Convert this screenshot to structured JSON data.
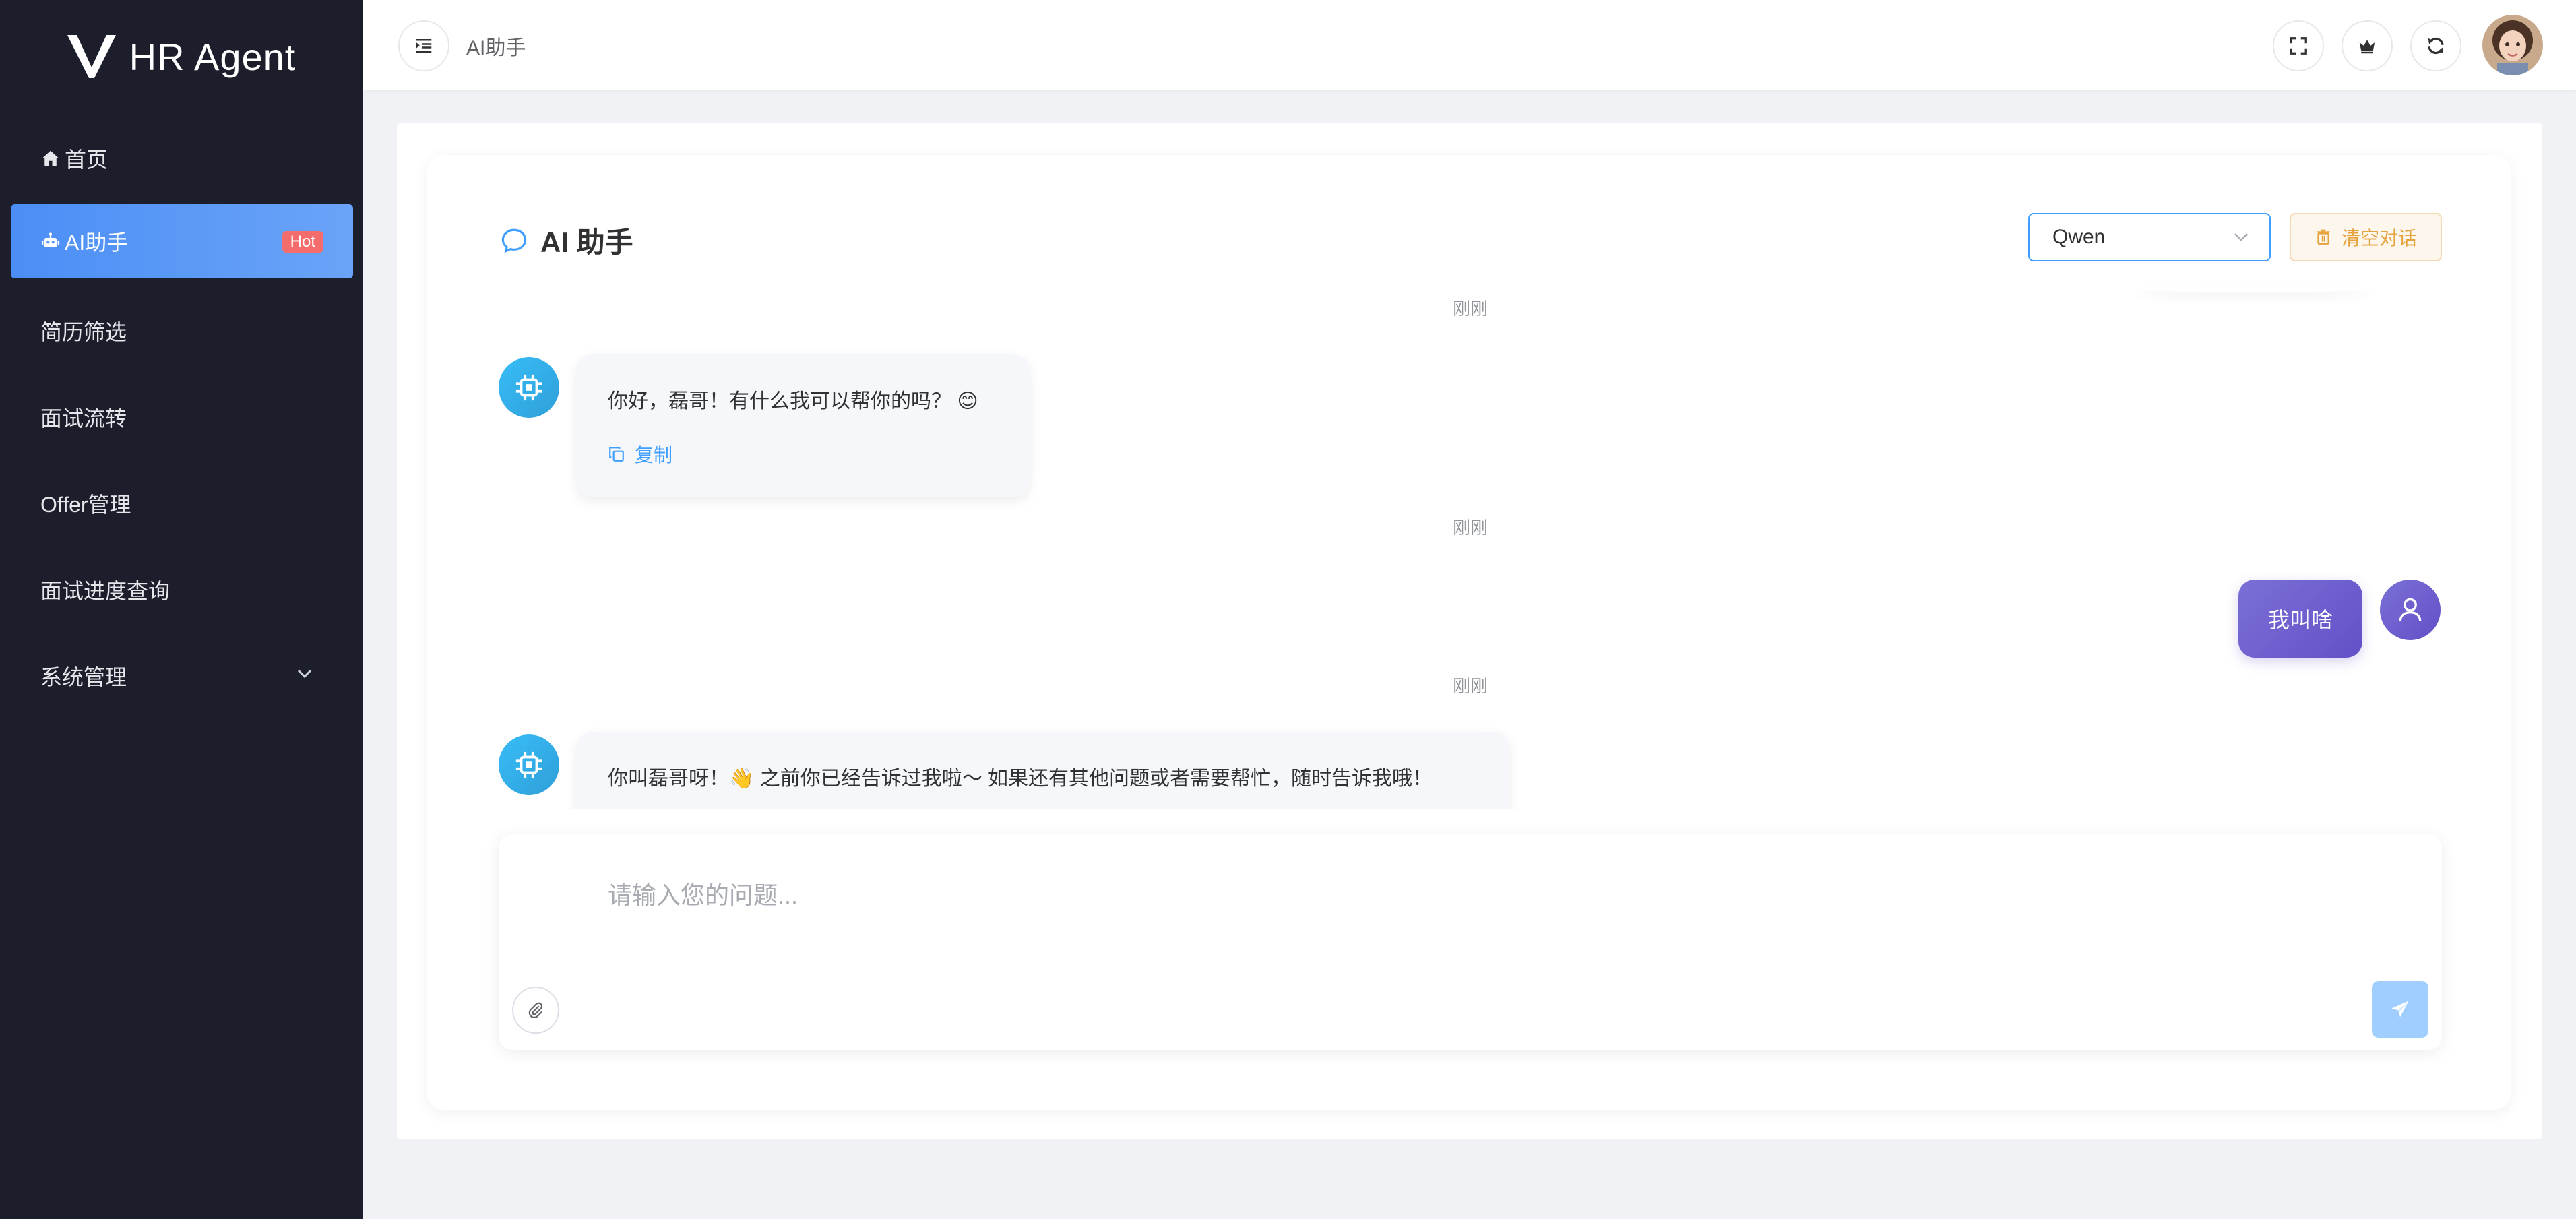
{
  "app": {
    "logo_text": "HR Agent"
  },
  "sidebar": {
    "items": [
      {
        "label": "首页",
        "icon": "home-icon"
      },
      {
        "label": "AI助手",
        "icon": "robot-icon",
        "badge": "Hot",
        "active": true
      },
      {
        "label": "简历筛选"
      },
      {
        "label": "面试流转"
      },
      {
        "label": "Offer管理"
      },
      {
        "label": "面试进度查询"
      },
      {
        "label": "系统管理",
        "icon": "chevron-down-icon"
      }
    ]
  },
  "header": {
    "breadcrumb": "AI助手",
    "icons": [
      "menu-fold-icon",
      "fullscreen-icon",
      "crown-icon",
      "refresh-icon"
    ]
  },
  "chat": {
    "title": "AI 助手",
    "model": "Qwen",
    "clear_label": "清空对话",
    "messages": [
      {
        "role": "assistant",
        "time": "刚刚",
        "text": "你好，磊哥！有什么我可以帮你的吗？ 😊",
        "copy_label": "复制"
      },
      {
        "role": "user",
        "time": "刚刚",
        "text": "我叫啥"
      },
      {
        "role": "assistant",
        "time": "刚刚",
        "text": "你叫磊哥呀！👋 之前你已经告诉过我啦～ 如果还有其他问题或者需要帮忙，随时告诉我哦！"
      }
    ]
  },
  "input": {
    "placeholder": "请输入您的问题..."
  },
  "colors": {
    "sidebar_bg": "#1c1e2b",
    "accent": "#409eff",
    "user_bubble": "#6250c7",
    "warning": "#e6a23c"
  }
}
